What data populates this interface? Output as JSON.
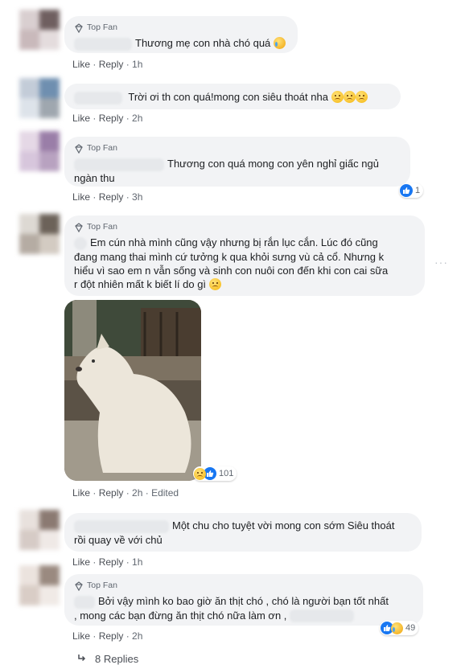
{
  "top_fan_label": "Top Fan",
  "like_label": "Like",
  "reply_label": "Reply",
  "comments": [
    {
      "badge": true,
      "text": "Thương mẹ con nhà chó quá",
      "time": "1h"
    },
    {
      "badge": false,
      "text": "Trời ơi th con quá!mong con siêu thoát nha",
      "time": "2h"
    },
    {
      "badge": true,
      "text_line1": "Thương con quá mong con yên nghỉ giấc ngủ",
      "text_line2": "ngàn thu",
      "time": "3h",
      "reaction_count": "1"
    },
    {
      "badge": true,
      "lines": [
        "Em cún nhà mình cũng vậy nhưng bị rắn lục cắn. Lúc đó cũng",
        "đang mang thai mình cứ tưởng k qua khỏi sưng vù cả cổ. Nhưng k",
        "hiểu vì sao em n vẫn sống và sinh con nuôi con đến khi con cai sữa",
        "r đột nhiên mất k biết lí do gì"
      ],
      "time": "2h",
      "edited": "Edited",
      "reaction_count": "101"
    },
    {
      "badge": false,
      "text_line1": "Một chu cho tuyệt vời mong con sớm Siêu thoát",
      "text_line2": "rồi quay về với chủ",
      "time": "1h"
    },
    {
      "badge": true,
      "text_line1": "Bởi vậy mình ko bao giờ ăn thịt chó , chó là người bạn tốt nhất",
      "text_line2": ", mong các bạn đừng ăn thịt chó nữa làm ơn ,",
      "time": "2h",
      "reaction_count": "49"
    }
  ],
  "replies_label": "8 Replies",
  "more_label": "···",
  "colors": {
    "accent": "#1877f2",
    "bubble": "#f2f3f5",
    "meta": "#606770"
  }
}
